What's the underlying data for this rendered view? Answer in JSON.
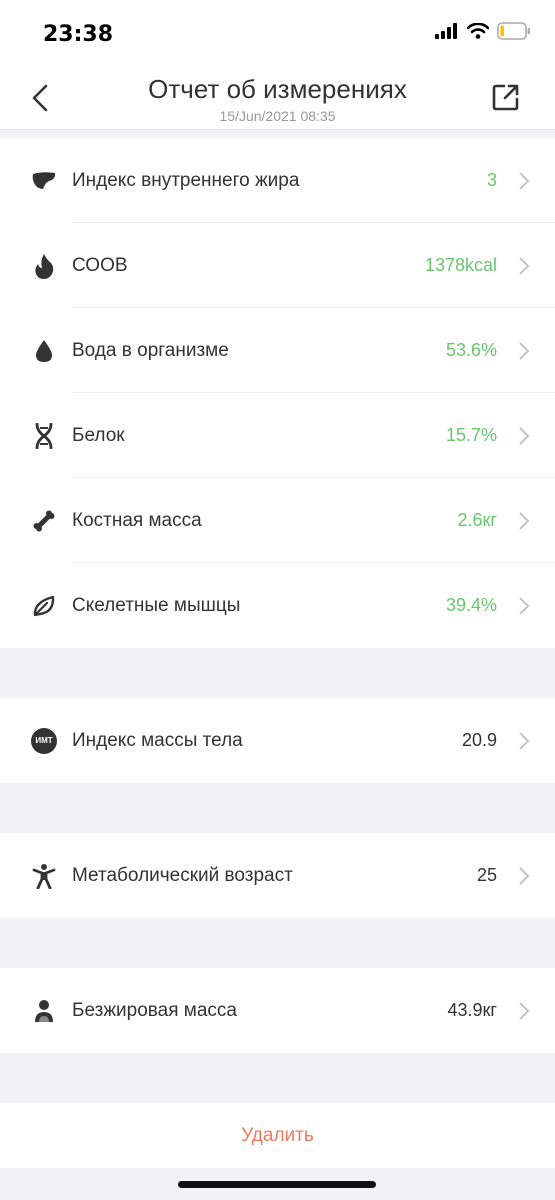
{
  "status": {
    "time": "23:38"
  },
  "header": {
    "title": "Отчет об измерениях",
    "subtitle": "15/Jun/2021 08:35"
  },
  "metrics": [
    {
      "label": "Индекс внутреннего жира",
      "value": "3",
      "icon": "liver-icon"
    },
    {
      "label": "СООВ",
      "value": "1378kcal",
      "icon": "flame-icon"
    },
    {
      "label": "Вода в организме",
      "value": "53.6%",
      "icon": "water-drop-icon"
    },
    {
      "label": "Белок",
      "value": "15.7%",
      "icon": "dna-icon"
    },
    {
      "label": "Костная масса",
      "value": "2.6кг",
      "icon": "bone-icon"
    },
    {
      "label": "Скелетные мышцы",
      "value": "39.4%",
      "icon": "leaf-icon"
    }
  ],
  "bmi": {
    "label": "Индекс массы тела",
    "value": "20.9",
    "badge": "ИМТ"
  },
  "metabolic_age": {
    "label": "Метаболический возраст",
    "value": "25"
  },
  "lean_mass": {
    "label": "Безжировая масса",
    "value": "43.9кг"
  },
  "actions": {
    "delete_label": "Удалить"
  },
  "colors": {
    "accent_green": "#68c76c",
    "delete_red": "#f07a5c"
  }
}
